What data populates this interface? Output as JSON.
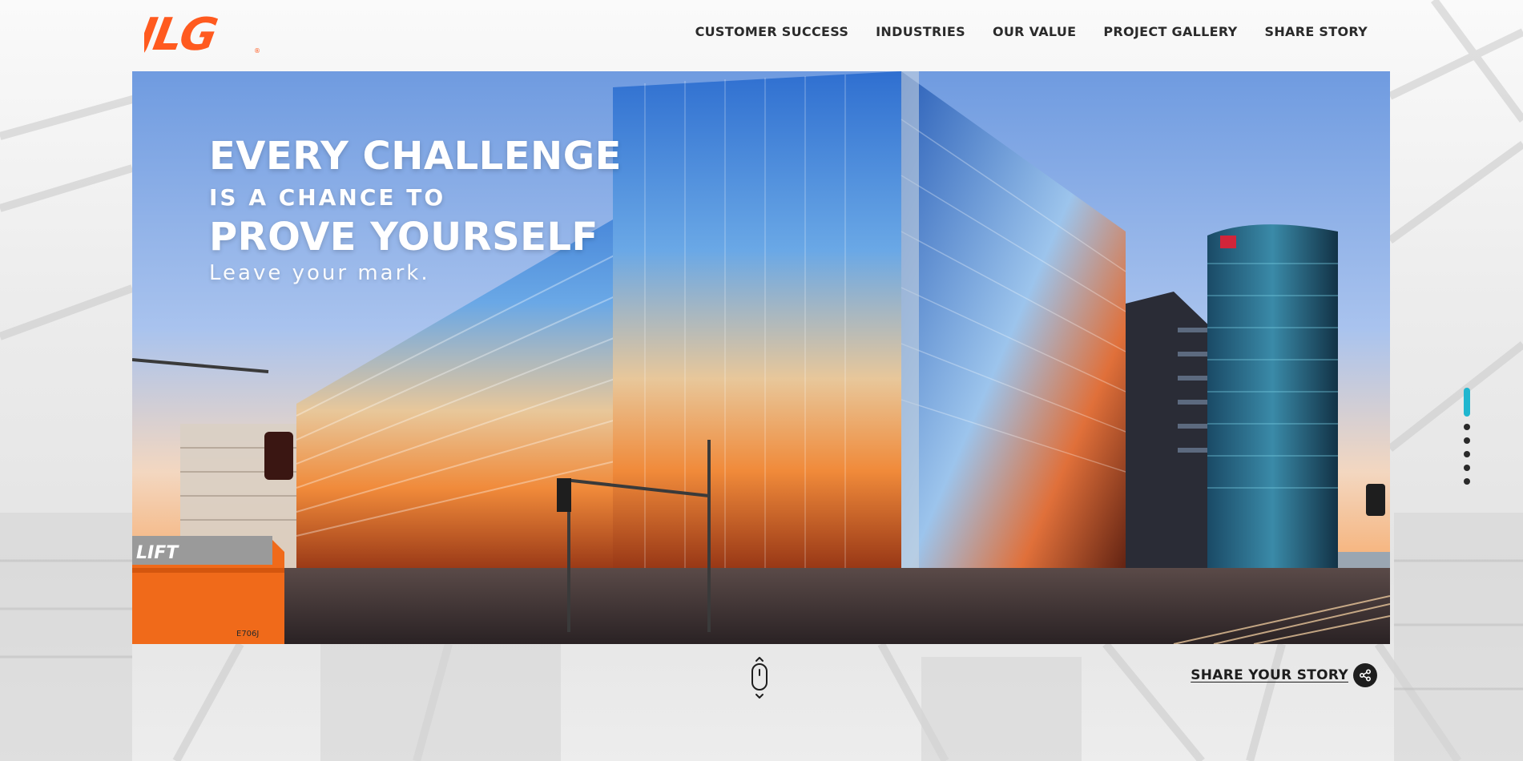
{
  "brand": {
    "logo_text": "JLG",
    "logo_color": "#ff5a1f"
  },
  "nav": {
    "items": [
      {
        "label": "CUSTOMER SUCCESS"
      },
      {
        "label": "INDUSTRIES"
      },
      {
        "label": "OUR VALUE"
      },
      {
        "label": "PROJECT GALLERY"
      },
      {
        "label": "SHARE STORY"
      }
    ]
  },
  "hero": {
    "line1": "EVERY CHALLENGE",
    "line2": "IS A CHANCE TO",
    "line3": "PROVE YOURSELF",
    "line4": "Leave your mark.",
    "machine_label": "LIFT",
    "machine_model": "E706J"
  },
  "pager": {
    "total": 6,
    "active_index": 0,
    "active_color": "#1fb6cf"
  },
  "share": {
    "label": "SHARE YOUR STORY",
    "icon": "share-icon"
  },
  "scroll": {
    "icon": "mouse-scroll-icon"
  }
}
